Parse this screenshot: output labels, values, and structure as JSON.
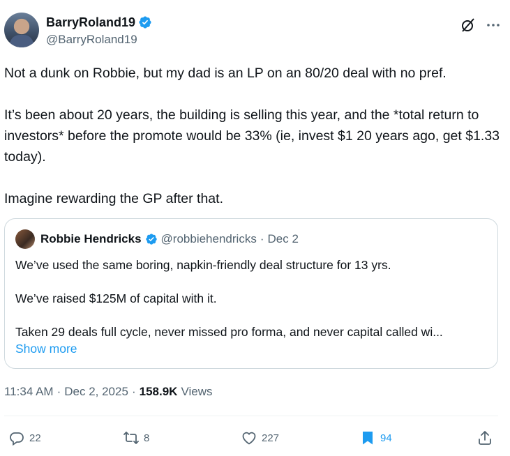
{
  "author": {
    "display_name": "BarryRoland19",
    "handle": "@BarryRoland19"
  },
  "tweet": {
    "paragraphs": [
      "Not a dunk on Robbie, but my dad is an LP on an 80/20 deal with no pref.",
      "It’s been about 20 years, the building is selling this year, and the *total return to investors* before the promote would be 33% (ie, invest $1 20 years ago, get $1.33 today).",
      "Imagine rewarding the GP after that."
    ]
  },
  "quote": {
    "display_name": "Robbie Hendricks",
    "handle": "@robbiehendricks",
    "separator": "·",
    "date": "Dec 2",
    "paragraphs": [
      "We’ve used the same boring, napkin-friendly deal structure for 13 yrs.",
      "We’ve raised $125M of capital with it.",
      "Taken 29 deals full cycle, never missed pro forma, and never capital called wi..."
    ],
    "show_more": "Show more"
  },
  "meta": {
    "time": "11:34 AM",
    "sep1": "·",
    "date": "Dec 2, 2025",
    "sep2": "·",
    "views_count": "158.9K",
    "views_label": "Views"
  },
  "actions": {
    "replies": "22",
    "reposts": "8",
    "likes": "227",
    "bookmarks": "94"
  },
  "colors": {
    "accent": "#1d9bf0",
    "text": "#0f1419",
    "muted": "#536471",
    "border": "#cfd9de"
  },
  "icons": [
    "verified-icon",
    "grok-icon",
    "more-icon",
    "reply-icon",
    "repost-icon",
    "like-icon",
    "bookmark-icon",
    "share-icon"
  ]
}
